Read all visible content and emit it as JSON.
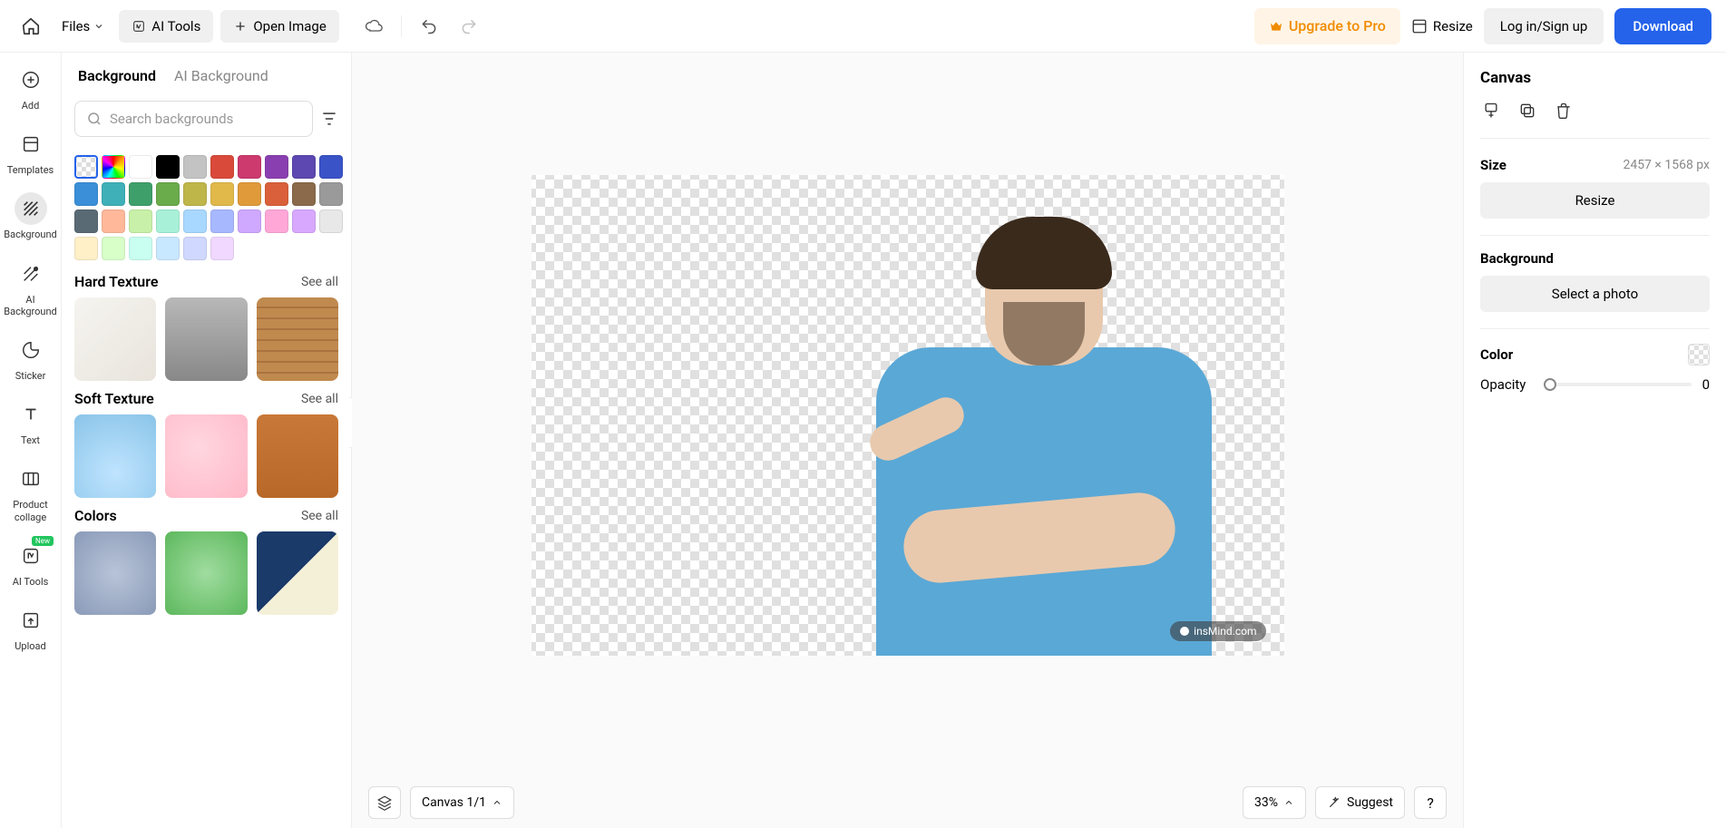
{
  "topbar": {
    "files_label": "Files",
    "ai_tools_label": "AI Tools",
    "open_image_label": "Open Image",
    "upgrade_label": "Upgrade to Pro",
    "resize_label": "Resize",
    "login_label": "Log in/Sign up",
    "download_label": "Download"
  },
  "rail": {
    "items": [
      {
        "label": "Add"
      },
      {
        "label": "Templates"
      },
      {
        "label": "Background"
      },
      {
        "label": "AI Background"
      },
      {
        "label": "Sticker"
      },
      {
        "label": "Text"
      },
      {
        "label": "Product collage"
      },
      {
        "label": "AI Tools",
        "badge": "New"
      },
      {
        "label": "Upload"
      }
    ]
  },
  "panel": {
    "tab_background": "Background",
    "tab_ai_background": "AI Background",
    "search_placeholder": "Search backgrounds",
    "swatch_colors": [
      "#ffffff",
      "#000000",
      "#c3c3c3",
      "#d94a3a",
      "#cc3a6e",
      "#8a3fb0",
      "#5c48b0",
      "#3a53c7",
      "#3a8fd8",
      "#3fb0b8",
      "#3f9f6b",
      "#6aab4b",
      "#bfb64a",
      "#e0b94a",
      "#e09a3a",
      "#d9603a",
      "#8a6a4a",
      "#9a9a9a",
      "#5a6a74",
      "#ffb89a",
      "#c8f0a8",
      "#a8f0d8",
      "#a8d8ff",
      "#a8b8ff",
      "#cfa8ff",
      "#ffa8d8",
      "#d8a8ff",
      "#e8e8e8",
      "#fff0c8",
      "#d8ffc8",
      "#c8fff0",
      "#c8e8ff",
      "#d0d8ff",
      "#f0d8ff"
    ],
    "sections": {
      "hard_texture": {
        "title": "Hard Texture",
        "see_all": "See all"
      },
      "soft_texture": {
        "title": "Soft Texture",
        "see_all": "See all"
      },
      "colors": {
        "title": "Colors",
        "see_all": "See all"
      }
    }
  },
  "canvas": {
    "watermark": "insMind.com",
    "canvas_chip": "Canvas 1/1",
    "zoom": "33%",
    "suggest": "Suggest",
    "help": "?"
  },
  "right_panel": {
    "canvas_title": "Canvas",
    "size_label": "Size",
    "size_value": "2457 × 1568 px",
    "resize_btn": "Resize",
    "background_label": "Background",
    "select_photo_btn": "Select a photo",
    "color_label": "Color",
    "opacity_label": "Opacity",
    "opacity_value": "0"
  }
}
